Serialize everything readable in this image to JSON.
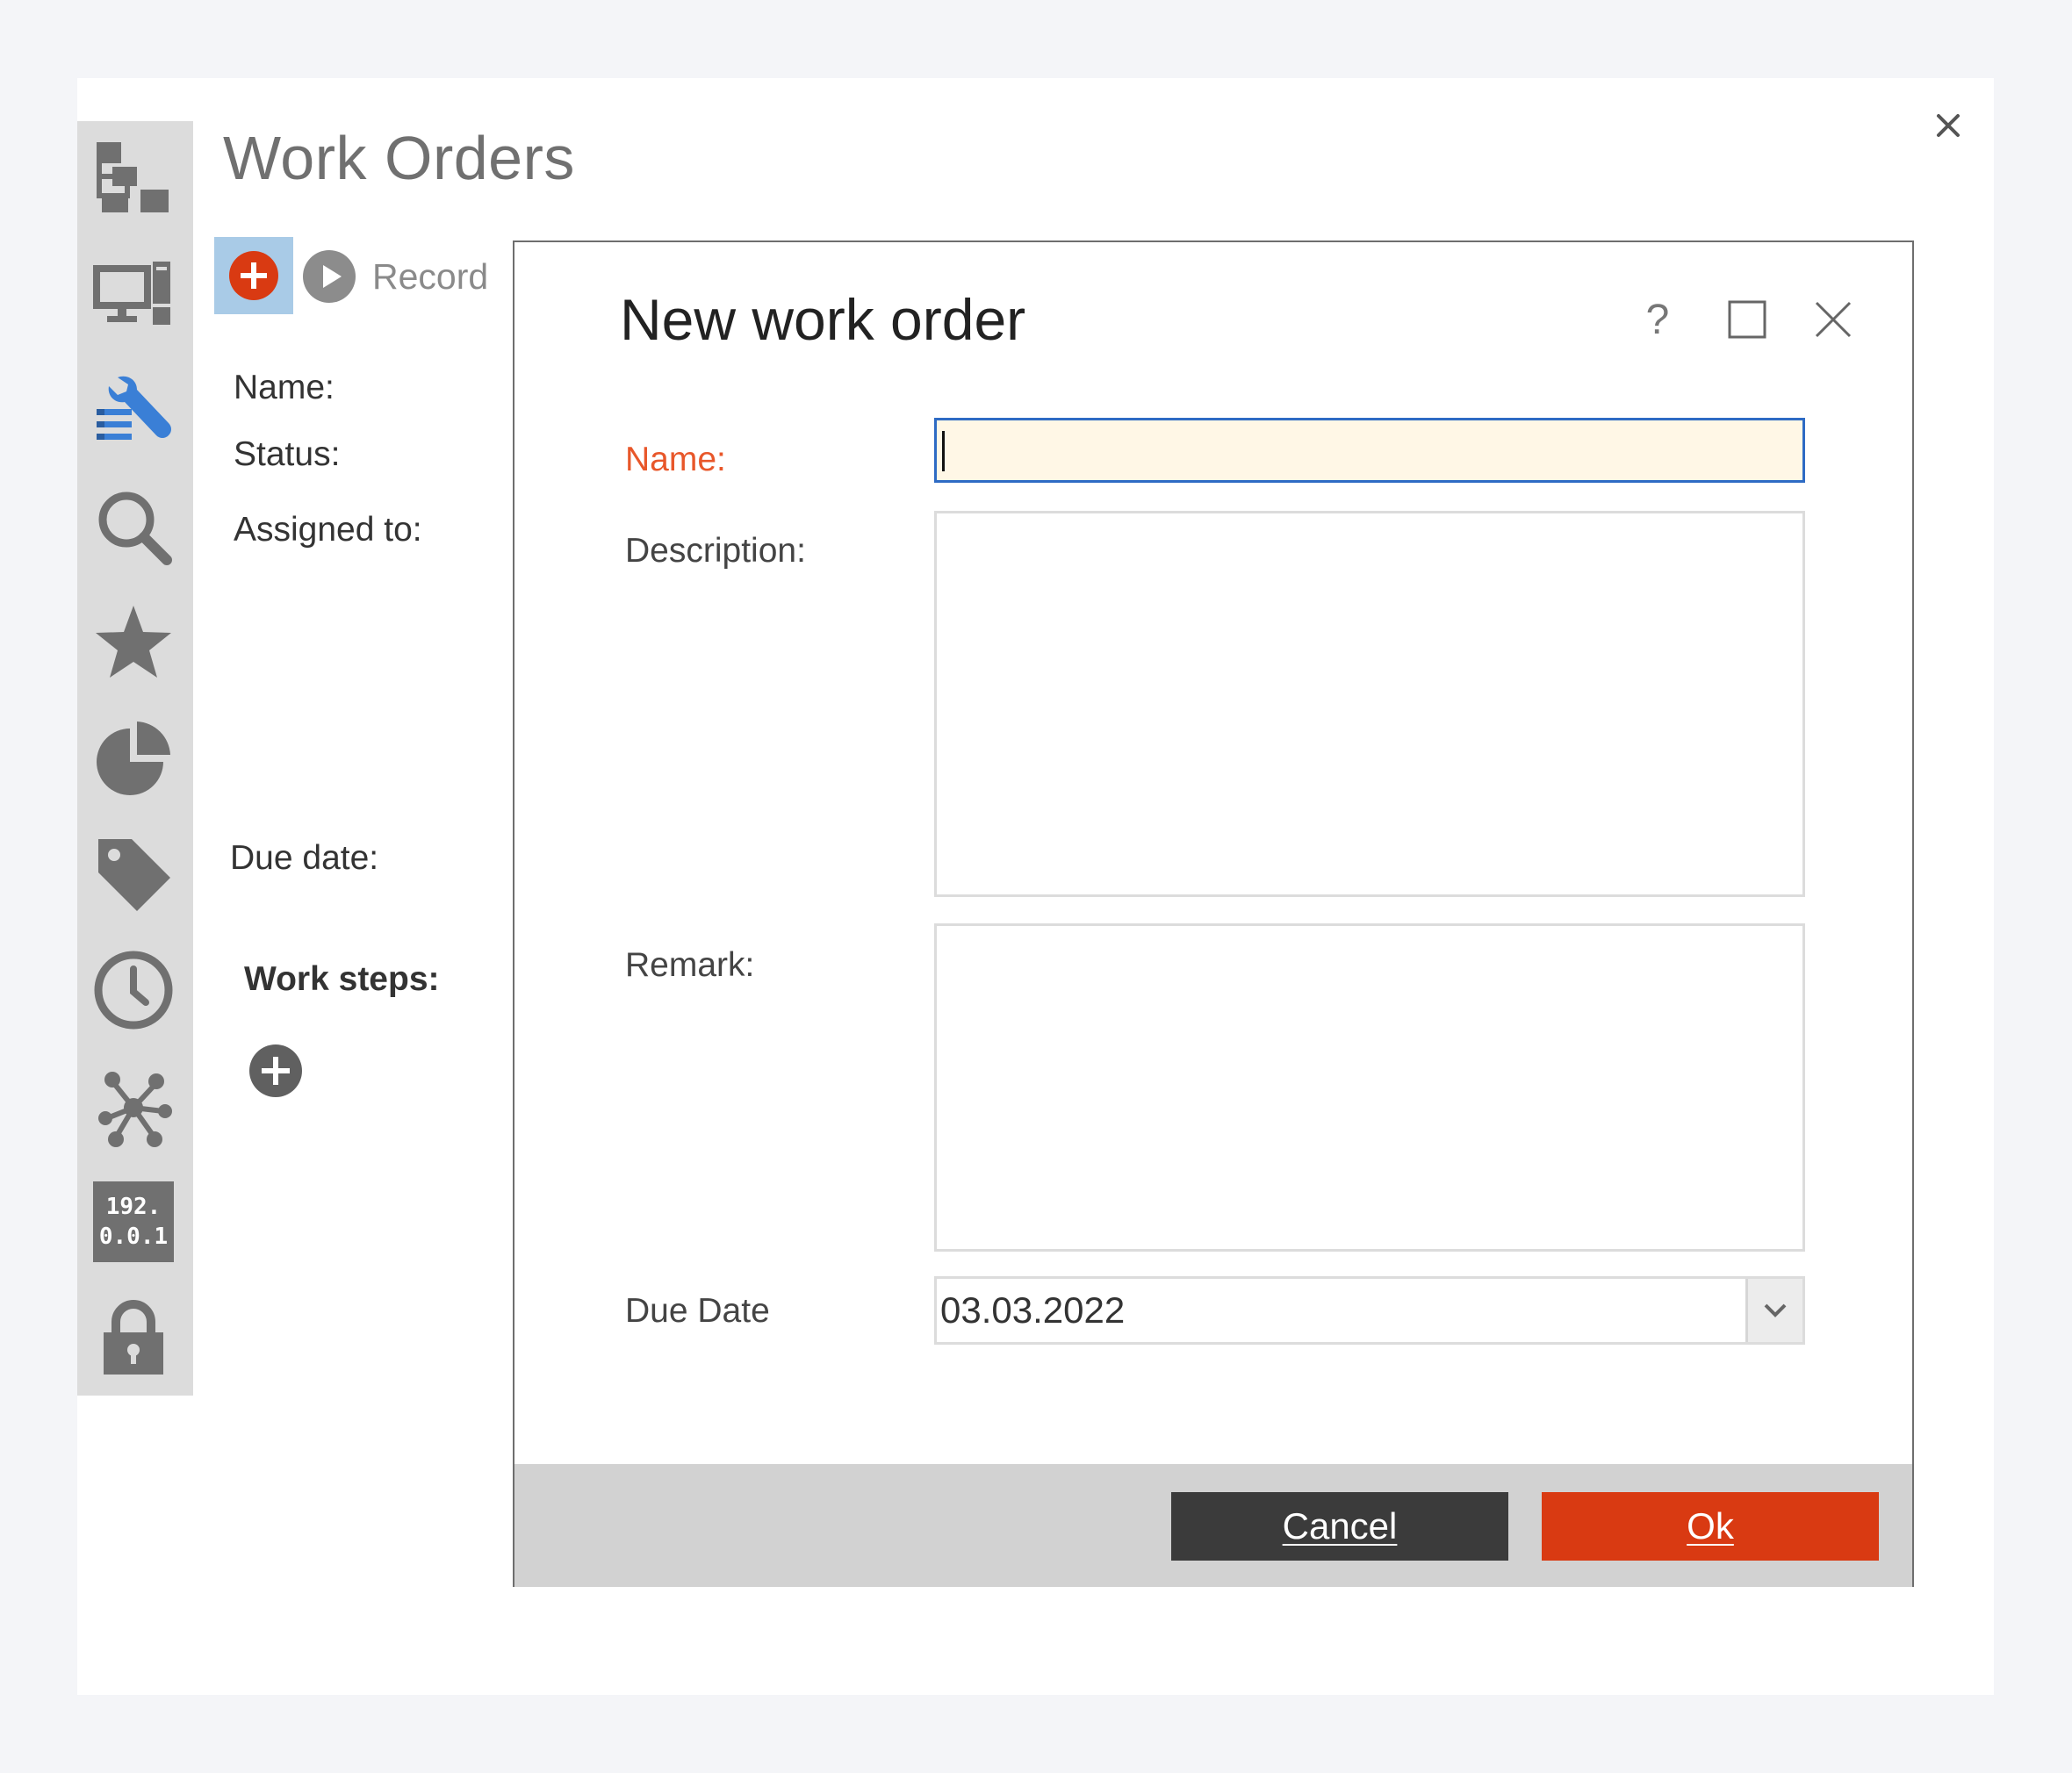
{
  "app": {
    "title": "Work Orders"
  },
  "toolbar": {
    "add_icon": "plus-circle-icon",
    "record_label": "Record"
  },
  "form_labels": {
    "name": "Name:",
    "status": "Status:",
    "assigned_to": "Assigned to:",
    "due_date": "Due date:",
    "work_steps": "Work steps:"
  },
  "sidebar": {
    "items": [
      {
        "icon": "hierarchy-icon"
      },
      {
        "icon": "devices-icon"
      },
      {
        "icon": "wrench-list-icon",
        "active": true
      },
      {
        "icon": "search-icon"
      },
      {
        "icon": "star-icon"
      },
      {
        "icon": "pie-chart-icon"
      },
      {
        "icon": "tag-icon"
      },
      {
        "icon": "clock-icon"
      },
      {
        "icon": "network-icon"
      },
      {
        "icon": "ip-address-icon",
        "text_line1": "192.",
        "text_line2": "0.0.1"
      },
      {
        "icon": "lock-icon"
      }
    ]
  },
  "dialog": {
    "title": "New work order",
    "help_label": "?",
    "fields": {
      "name_label": "Name:",
      "name_value": "",
      "description_label": "Description:",
      "description_value": "",
      "remark_label": "Remark:",
      "remark_value": "",
      "due_date_label": "Due Date",
      "due_date_value": "03.03.2022"
    },
    "buttons": {
      "cancel": "Cancel",
      "ok": "Ok"
    }
  },
  "colors": {
    "accent_red": "#d93a12",
    "required_label": "#e8572a",
    "active_icon": "#3a7fd6",
    "sidebar_bg": "#dcdcdc",
    "dark_button": "#3b3b3b",
    "focus_field_bg": "#fff7e6"
  }
}
